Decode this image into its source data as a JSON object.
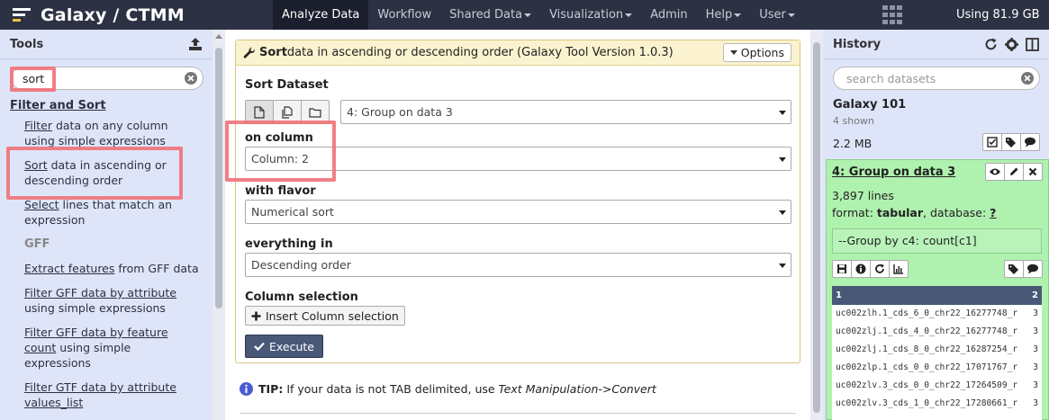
{
  "masthead": {
    "title": "Galaxy / CTMM",
    "nav": [
      {
        "label": "Analyze Data",
        "active": true,
        "dropdown": false
      },
      {
        "label": "Workflow",
        "active": false,
        "dropdown": false
      },
      {
        "label": "Shared Data",
        "active": false,
        "dropdown": true
      },
      {
        "label": "Visualization",
        "active": false,
        "dropdown": true
      },
      {
        "label": "Admin",
        "active": false,
        "dropdown": false
      },
      {
        "label": "Help",
        "active": false,
        "dropdown": true
      },
      {
        "label": "User",
        "active": false,
        "dropdown": true
      }
    ],
    "usage": "Using 81.9 GB",
    "icons": [
      "galaxy-logo-icon",
      "grid-icon"
    ]
  },
  "tools": {
    "header": "Tools",
    "search_value": "sort",
    "sections": [
      {
        "label": "Filter and Sort"
      },
      {
        "label": "GFF"
      }
    ],
    "items": [
      {
        "link": "Filter",
        "rest1": " data on any column",
        "line2": "using simple expressions"
      },
      {
        "link": "Sort",
        "rest1": " data in ascending or",
        "line2": "descending order"
      },
      {
        "link": "Select",
        "rest1": " lines that match an",
        "line2": "expression"
      },
      {
        "link": "Extract features",
        "rest1": " from GFF data",
        "line2": ""
      },
      {
        "link": "Filter GFF data by attribute",
        "rest1": "",
        "line2": "using simple expressions"
      },
      {
        "link": "Filter GFF data by feature",
        "rest1": "",
        "line2_link": "count",
        "line2": " using simple",
        "line3": "expressions"
      },
      {
        "link": "Filter GTF data by attribute",
        "rest1": "",
        "line2_link": "values_list",
        "line2": ""
      }
    ]
  },
  "form": {
    "title_bold": "Sort",
    "title_rest": " data in ascending or descending order (Galaxy Tool Version 1.0.3)",
    "options_label": "Options",
    "dataset_label": "Sort Dataset",
    "dataset_value": "4: Group on data 3",
    "column_label": "on column",
    "column_value": "Column: 2",
    "flavor_label": "with flavor",
    "flavor_value": "Numerical sort",
    "order_label": "everything in",
    "order_value": "Descending order",
    "colsel_label": "Column selection",
    "insert_label": "Insert Column selection",
    "execute_label": "Execute",
    "tip_bold": "TIP:",
    "tip_text": " If your data is not TAB delimited, use ",
    "tip_italic": "Text Manipulation->Convert"
  },
  "history": {
    "header": "History",
    "search_placeholder": "search datasets",
    "name": "Galaxy 101",
    "shown": "4 shown",
    "size": "2.2 MB",
    "dataset": {
      "title": "4: Group on data 3",
      "lines": "3,897 lines",
      "format_label": "format: ",
      "format_value": "tabular",
      "database_label": ", database: ",
      "database_value": "?",
      "info": "--Group by c4: count[c1]",
      "peek_headers": [
        "1",
        "2"
      ],
      "peek_rows": [
        {
          "c1": "uc002zlh.1_cds_6_0_chr22_16277748_r",
          "c2": "3"
        },
        {
          "c1": "uc002zlj.1_cds_4_0_chr22_16277748_r",
          "c2": "3"
        },
        {
          "c1": "uc002zlj.1_cds_8_0_chr22_16287254_r",
          "c2": "3"
        },
        {
          "c1": "uc002zlp.1_cds_0_0_chr22_17071767_r",
          "c2": "3"
        },
        {
          "c1": "uc002zlv.3_cds_0_0_chr22_17264509_r",
          "c2": "3"
        },
        {
          "c1": "uc002zlv.3_cds_1_0_chr22_17280661_r",
          "c2": "3"
        }
      ]
    }
  },
  "colors": {
    "masthead": "#2c3143",
    "panel": "#dfe5f9",
    "highlight": "#f07178",
    "dataset_ok": "#aff1af",
    "execute": "#4a5878"
  }
}
